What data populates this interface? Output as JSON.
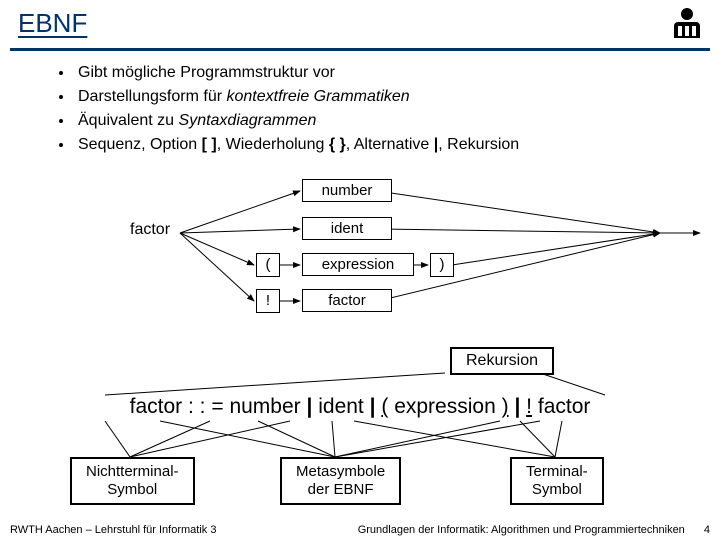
{
  "title": "EBNF",
  "bullets": [
    {
      "plain": "Gibt mögliche Programmstruktur vor"
    },
    {
      "pre": "Darstellungsform für ",
      "em": "kontextfreie Grammatiken"
    },
    {
      "pre": "Äquivalent zu ",
      "em": "Syntaxdiagrammen"
    },
    {
      "seq": true
    }
  ],
  "seqParts": {
    "a": "Sequenz, Option ",
    "b": "[ ]",
    "c": ", Wiederholung ",
    "d": "{ }",
    "e": ", Alternative ",
    "f": "|",
    "g": ", Rekursion"
  },
  "diagram": {
    "factor": "factor",
    "number": "number",
    "ident": "ident",
    "expression": "expression",
    "factor2": "factor",
    "lp": "(",
    "rp": ")",
    "bang": "!"
  },
  "rekursion": "Rekursion",
  "formula": {
    "factor": "factor",
    "def": ": : =",
    "number": "number",
    "bar": "|",
    "ident": "ident",
    "lp": "(",
    "expression": "expression",
    "rp": ")",
    "bang": "!",
    "factor2": "factor"
  },
  "ann": {
    "nonterm": "Nichtterminal-\nSymbol",
    "meta": "Metasymbole\nder EBNF",
    "term": "Terminal-\nSymbol"
  },
  "footer": {
    "left": "RWTH Aachen – Lehrstuhl für Informatik 3",
    "right": "Grundlagen der Informatik: Algorithmen und Programmiertechniken",
    "page": "4"
  }
}
